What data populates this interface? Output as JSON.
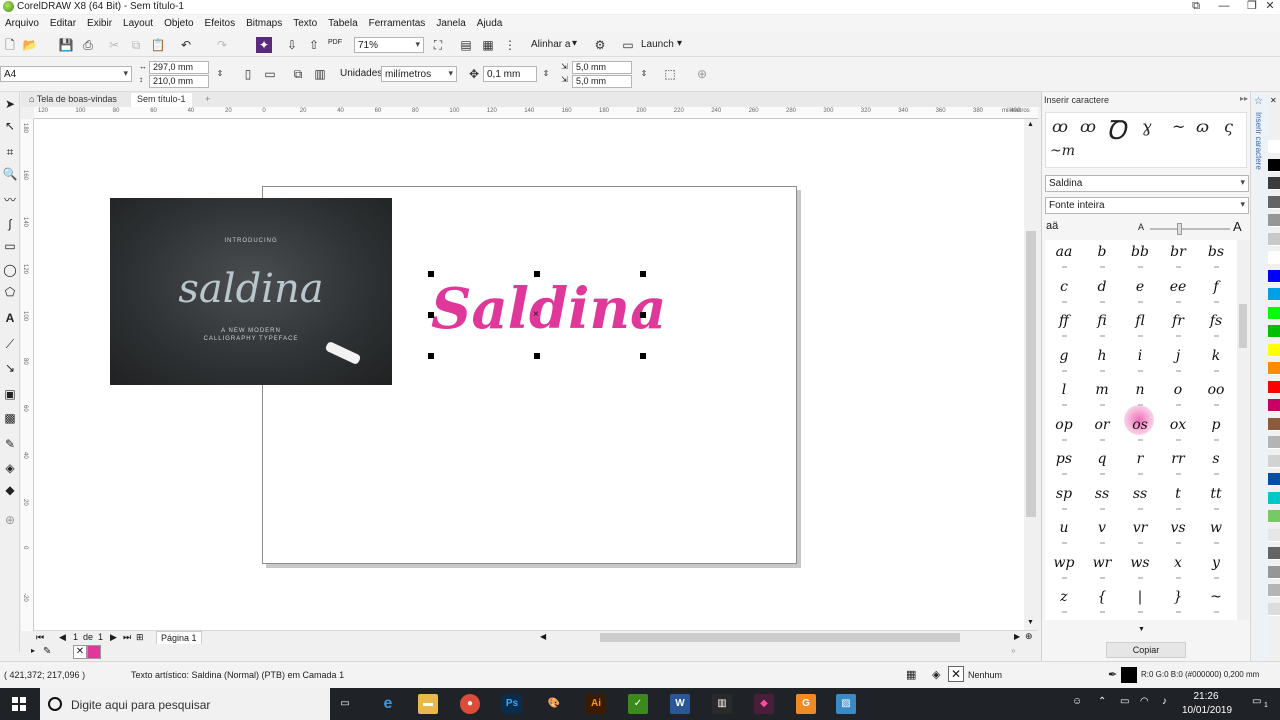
{
  "window": {
    "title": "CorelDRAW X8 (64 Bit) - Sem título-1"
  },
  "menu": [
    "Arquivo",
    "Editar",
    "Exibir",
    "Layout",
    "Objeto",
    "Efeitos",
    "Bitmaps",
    "Texto",
    "Tabela",
    "Ferramentas",
    "Janela",
    "Ajuda"
  ],
  "toolbar": {
    "zoom": "71%",
    "snap_label": "Alinhar a",
    "launch_label": "Launch",
    "pdf_label": "PDF"
  },
  "property_bar": {
    "page_size": "A4",
    "width": "297,0 mm",
    "height": "210,0 mm",
    "units_label": "Unidades:",
    "units_value": "milímetros",
    "nudge": "0,1 mm",
    "dup_x": "5,0 mm",
    "dup_y": "5,0 mm"
  },
  "tabs": [
    "Tela de boas-vindas",
    "Sem título-1"
  ],
  "ruler": {
    "top_ticks": [
      "120",
      "100",
      "80",
      "60",
      "40",
      "20",
      "0",
      "20",
      "40",
      "60",
      "80",
      "100",
      "120",
      "140",
      "160",
      "180",
      "200",
      "220",
      "240",
      "260",
      "280",
      "300",
      "320",
      "340",
      "360",
      "380",
      "400"
    ],
    "top_unit": "milímetros",
    "left_ticks": [
      "180",
      "160",
      "140",
      "120",
      "100",
      "80",
      "60",
      "40",
      "20",
      "0",
      "-20"
    ]
  },
  "canvas": {
    "chalkboard": {
      "intro": "INTRODUCING",
      "script": "saldina",
      "line1": "A NEW MODERN",
      "line2": "CALLIGRAPHY TYPEFACE"
    },
    "artistic_text": "Saldina"
  },
  "pages": {
    "current": "1",
    "of_label": "de",
    "total": "1",
    "page_tab": "Página 1"
  },
  "status": {
    "coords": "( 421,372; 217,096 )",
    "object_info": "Texto artístico: Saldina (Normal) (PTB) em Camada 1",
    "fill_label": "Nenhum",
    "outline_info": "R:0 G:0 B:0 (#000000)  0,200 mm"
  },
  "docker": {
    "header": "Inserir caractere",
    "side_tab": "Inserir caractere",
    "recent_glyphs": [
      "ꝏ",
      "ꝏ",
      "Ꝺ",
      "ɣ",
      "~",
      "ɷ",
      "ς",
      "~m"
    ],
    "font": "Saldina",
    "filter": "Fonte inteira",
    "glyphs": [
      "aa",
      "b",
      "bb",
      "br",
      "bs",
      "c",
      "d",
      "e",
      "ee",
      "f",
      "ff",
      "fi",
      "fl",
      "fr",
      "fs",
      "g",
      "h",
      "i",
      "j",
      "k",
      "l",
      "m",
      "n",
      "o",
      "oo",
      "op",
      "or",
      "os",
      "ox",
      "p",
      "ps",
      "q",
      "r",
      "rr",
      "s",
      "sp",
      "ss",
      "ss",
      "t",
      "tt",
      "u",
      "v",
      "vr",
      "vs",
      "w",
      "wp",
      "wr",
      "ws",
      "x",
      "y",
      "z",
      "{",
      "|",
      "}",
      "~"
    ],
    "copy_label": "Copiar"
  },
  "taskbar": {
    "search_placeholder": "Digite aqui para pesquisar",
    "time": "21:26",
    "date": "10/01/2019",
    "notif_count": "1"
  },
  "colors": {
    "accent": "#e0379a",
    "chalk": "#2e3133"
  },
  "palette": [
    "#ffffff",
    "#000000",
    "#3c3c3c",
    "#646464",
    "#969696",
    "#c8c8c8",
    "#ffffff",
    "#0000ff",
    "#00a0e9",
    "#00ff00",
    "#00c000",
    "#ffff00",
    "#ff8c00",
    "#ff0000",
    "#c80064",
    "#8c5a3c",
    "#b4b4b4",
    "#d2d2d2",
    "#0050a0",
    "#00c8c8",
    "#78c864",
    "#e6e6e6",
    "#646464",
    "#969696",
    "#b4b4b4",
    "#dcdcdc"
  ]
}
